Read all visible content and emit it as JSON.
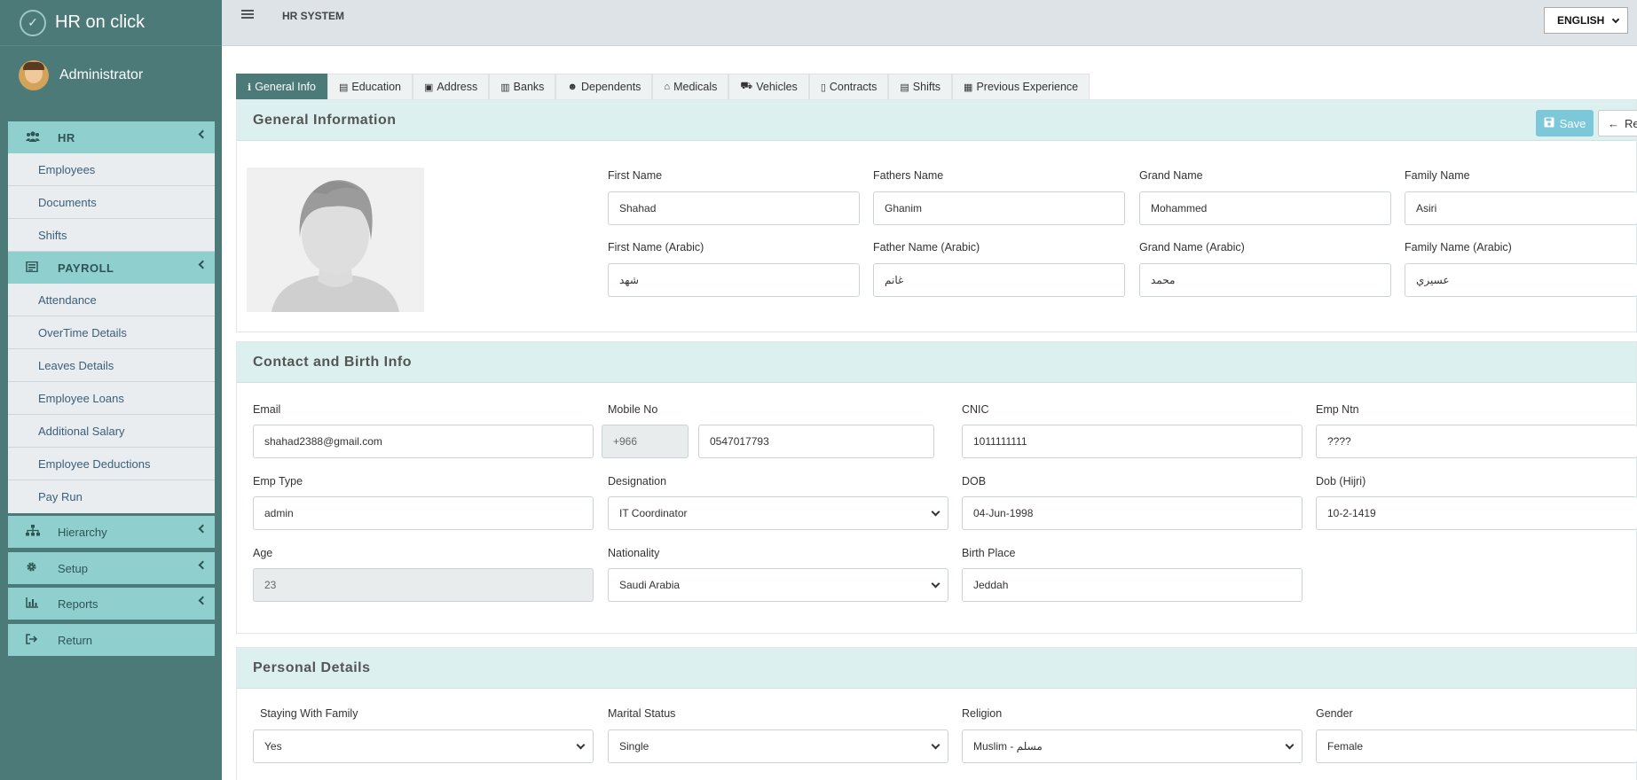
{
  "brand": {
    "name": "HR on click"
  },
  "user": {
    "name": "Administrator"
  },
  "topbar": {
    "title": "HR SYSTEM",
    "language": "ENGLISH"
  },
  "sidebar": {
    "hr": {
      "label": "HR",
      "items": [
        "Employees",
        "Documents",
        "Shifts"
      ]
    },
    "payroll": {
      "label": "PAYROLL",
      "items": [
        "Attendance",
        "OverTime Details",
        "Leaves Details",
        "Employee Loans",
        "Additional Salary",
        "Employee Deductions",
        "Pay Run"
      ]
    },
    "hierarchy": "Hierarchy",
    "setup": "Setup",
    "reports": "Reports",
    "return": "Return"
  },
  "tabs": [
    "General Info",
    "Education",
    "Address",
    "Banks",
    "Dependents",
    "Medicals",
    "Vehicles",
    "Contracts",
    "Shifts",
    "Previous Experience"
  ],
  "general": {
    "title": "General Information",
    "save": "Save",
    "return_partial": "Re",
    "first_name": {
      "label": "First Name",
      "value": "Shahad"
    },
    "fathers_name": {
      "label": "Fathers Name",
      "value": "Ghanim"
    },
    "grand_name": {
      "label": "Grand Name",
      "value": "Mohammed"
    },
    "family_name": {
      "label": "Family Name",
      "value": "Asiri"
    },
    "first_name_ar": {
      "label": "First Name (Arabic)",
      "value": "شهد"
    },
    "father_name_ar": {
      "label": "Father Name (Arabic)",
      "value": "غانم"
    },
    "grand_name_ar": {
      "label": "Grand Name (Arabic)",
      "value": "محمد"
    },
    "family_name_ar": {
      "label": "Family Name (Arabic)",
      "value": "عسيري"
    }
  },
  "contact": {
    "title": "Contact and Birth Info",
    "email": {
      "label": "Email",
      "value": "shahad2388@gmail.com"
    },
    "mobile": {
      "label": "Mobile No",
      "code": "+966",
      "value": "0547017793"
    },
    "cnic": {
      "label": "CNIC",
      "value": "1011111111"
    },
    "emp_ntn": {
      "label": "Emp Ntn",
      "value": "????"
    },
    "emp_type": {
      "label": "Emp Type",
      "value": "admin"
    },
    "designation": {
      "label": "Designation",
      "value": "IT Coordinator"
    },
    "dob": {
      "label": "DOB",
      "value": "04-Jun-1998"
    },
    "dob_hijri": {
      "label": "Dob (Hijri)",
      "value": "10-2-1419"
    },
    "age": {
      "label": "Age",
      "value": "23"
    },
    "nationality": {
      "label": "Nationality",
      "value": "Saudi Arabia"
    },
    "birth_place": {
      "label": "Birth Place",
      "value": "Jeddah"
    }
  },
  "personal": {
    "title": "Personal Details",
    "staying": {
      "label": "Staying With Family",
      "value": "Yes"
    },
    "marital": {
      "label": "Marital Status",
      "value": "Single"
    },
    "religion": {
      "label": "Religion",
      "value": "Muslim - مسلم"
    },
    "gender": {
      "label": "Gender",
      "value": "Female"
    }
  }
}
